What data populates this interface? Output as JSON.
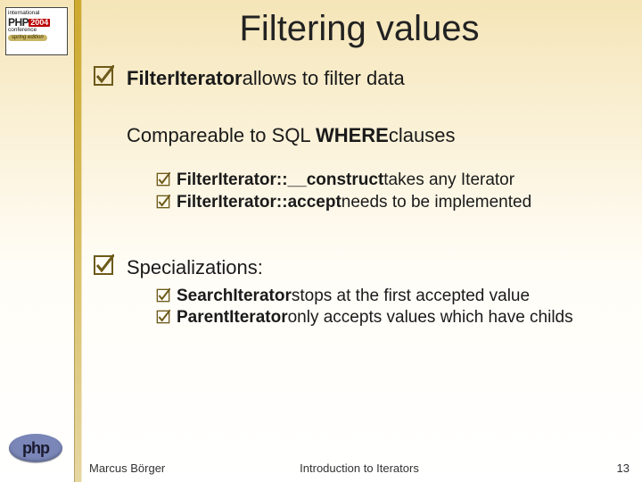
{
  "logo_top": {
    "line1": "international",
    "brand": "PHP",
    "year": "2004",
    "line3": "conference",
    "tag": "spring edition"
  },
  "logo_bottom": {
    "text": "php"
  },
  "title": "Filtering values",
  "bullets": {
    "b1_pre": "FilterIterator",
    "b1_post": "allows to filter data",
    "b2_pre": "Compareable to SQL ",
    "b2_bold": "WHERE",
    "b2_post": "clauses",
    "b3a_bold": "FilterIterator::__construct",
    "b3a_post": "takes any Iterator",
    "b3b_bold": "FilterIterator::accept",
    "b3b_post": "needs to be implemented",
    "b4": "Specializations:",
    "b4a_bold": "SearchIterator",
    "b4a_post": "stops at the first accepted value",
    "b4b_bold": "ParentIterator",
    "b4b_post": "only accepts values which have childs"
  },
  "footer": {
    "author": "Marcus Börger",
    "mid": "Introduction to Iterators",
    "page": "13"
  }
}
